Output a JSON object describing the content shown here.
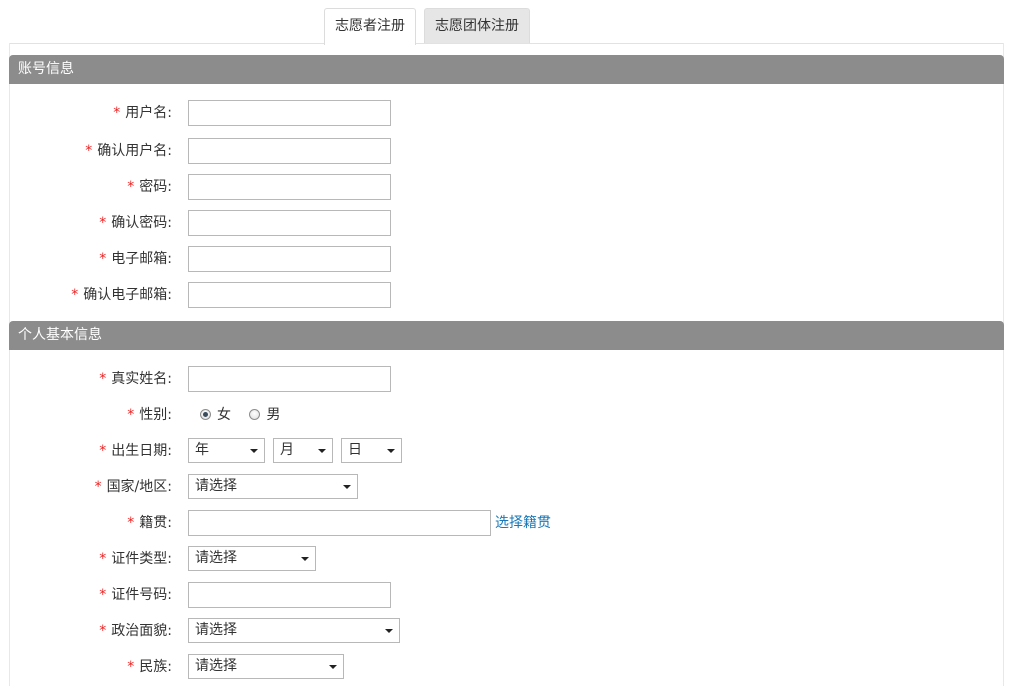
{
  "tabs": [
    {
      "label": "志愿者注册",
      "active": true
    },
    {
      "label": "志愿团体注册",
      "active": false
    }
  ],
  "required_mark": "*",
  "sections": {
    "account": {
      "title": "账号信息",
      "fields": [
        {
          "label": "用户名:",
          "value": ""
        },
        {
          "label": "确认用户名:",
          "value": ""
        },
        {
          "label": "密码:",
          "value": ""
        },
        {
          "label": "确认密码:",
          "value": ""
        },
        {
          "label": "电子邮箱:",
          "value": ""
        },
        {
          "label": "确认电子邮箱:",
          "value": ""
        }
      ]
    },
    "personal": {
      "title": "个人基本信息",
      "real_name": {
        "label": "真实姓名:",
        "value": ""
      },
      "gender": {
        "label": "性别:",
        "options": [
          {
            "label": "女",
            "checked": true
          },
          {
            "label": "男",
            "checked": false
          }
        ]
      },
      "birthdate": {
        "label": "出生日期:",
        "year": "年",
        "month": "月",
        "day": "日"
      },
      "country": {
        "label": "国家/地区:",
        "selected": "请选择"
      },
      "native_place": {
        "label": "籍贯:",
        "value": "",
        "link": "选择籍贯"
      },
      "id_type": {
        "label": "证件类型:",
        "selected": "请选择"
      },
      "id_number": {
        "label": "证件号码:",
        "value": ""
      },
      "political": {
        "label": "政治面貌:",
        "selected": "请选择"
      },
      "ethnicity": {
        "label": "民族:",
        "selected": "请选择"
      }
    }
  },
  "colors": {
    "section_header_bg": "#8c8c8c",
    "required": "#ee2222",
    "link": "#1a78b8"
  }
}
